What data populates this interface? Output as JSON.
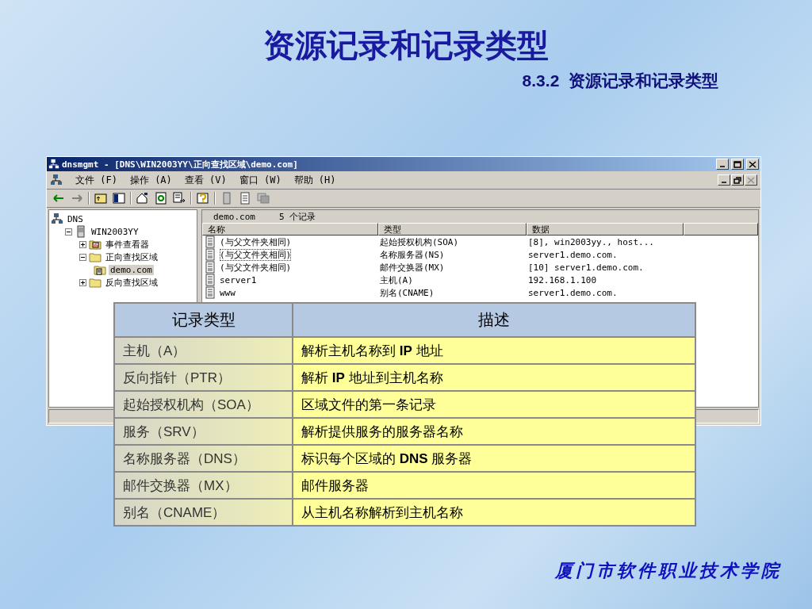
{
  "slide": {
    "title": "资源记录和记录类型",
    "subtitle": "8.3.2  资源记录和记录类型",
    "footer": "厦门市软件职业技术学院"
  },
  "window": {
    "title": "dnsmgmt - [DNS\\WIN2003YY\\正向查找区域\\demo.com]",
    "menu": [
      "文件 (F)",
      "操作 (A)",
      "查看 (V)",
      "窗口 (W)",
      "帮助 (H)"
    ],
    "tree": [
      {
        "label": "DNS",
        "kind": "network",
        "selected": false,
        "children": [
          {
            "label": "WIN2003YY",
            "kind": "server",
            "selected": false,
            "expanded": true,
            "children": [
              {
                "label": "事件查看器",
                "kind": "event",
                "selected": false,
                "expanded": false
              },
              {
                "label": "正向查找区域",
                "kind": "folder",
                "selected": false,
                "expanded": true,
                "children": [
                  {
                    "label": "demo.com",
                    "kind": "zone",
                    "selected": true
                  }
                ]
              },
              {
                "label": "反向查找区域",
                "kind": "folder",
                "selected": false,
                "expanded": false
              }
            ]
          }
        ]
      }
    ],
    "pane_header": {
      "zone": "demo.com",
      "count": "5 个记录"
    },
    "columns": [
      "名称",
      "类型",
      "数据"
    ],
    "rows": [
      {
        "name": "(与父文件夹相同)",
        "type": "起始授权机构(SOA)",
        "data": "[8], win2003yy., host...",
        "selected": false
      },
      {
        "name": "(与父文件夹相同)",
        "type": "名称服务器(NS)",
        "data": "server1.demo.com.",
        "selected": true
      },
      {
        "name": "(与父文件夹相同)",
        "type": "邮件交换器(MX)",
        "data": "[10]  server1.demo.com.",
        "selected": false
      },
      {
        "name": "server1",
        "type": "主机(A)",
        "data": "192.168.1.100",
        "selected": false
      },
      {
        "name": "www",
        "type": "别名(CNAME)",
        "data": "server1.demo.com.",
        "selected": false
      }
    ]
  },
  "table": {
    "columns": [
      "记录类型",
      "描述"
    ],
    "rows": [
      {
        "type": "主机（A）",
        "description": "解析主机名称到 **IP** 地址"
      },
      {
        "type": "反向指针（PTR）",
        "description": "解析 **IP** 地址到主机名称"
      },
      {
        "type": "起始授权机构（SOA）",
        "description": "区域文件的第一条记录"
      },
      {
        "type": "服务（SRV）",
        "description": "解析提供服务的服务器名称"
      },
      {
        "type": "名称服务器（DNS）",
        "description": "标识每个区域的 **DNS** 服务器"
      },
      {
        "type": "邮件交换器（MX）",
        "description": "邮件服务器"
      },
      {
        "type": "别名（CNAME）",
        "description": "从主机名称解析到主机名称"
      }
    ]
  }
}
